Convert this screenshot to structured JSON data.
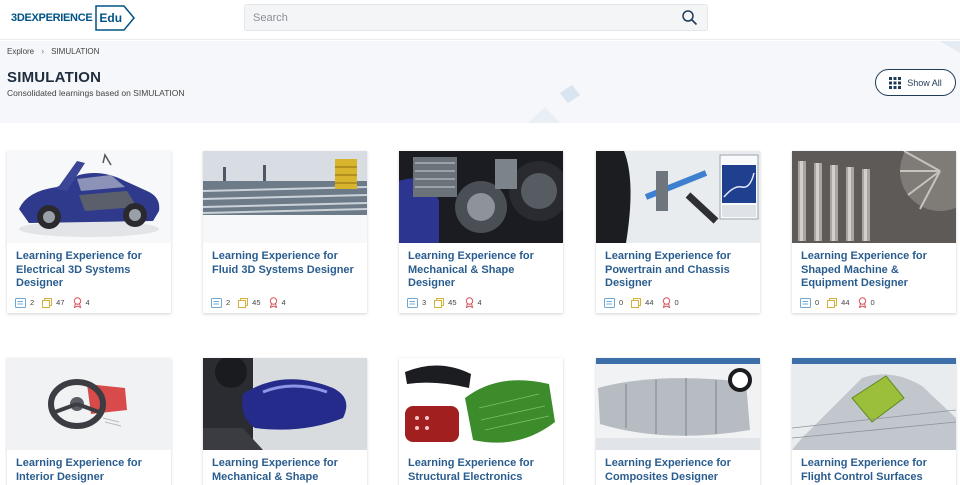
{
  "header": {
    "logo_text": "3DEXPERIENCE",
    "logo_badge": "Edu",
    "search_placeholder": "Search"
  },
  "breadcrumb": {
    "items": [
      "Explore",
      "SIMULATION"
    ]
  },
  "page": {
    "title": "SIMULATION",
    "subtitle": "Consolidated learnings based on SIMULATION",
    "show_all_label": "Show All"
  },
  "colors": {
    "brand": "#005386",
    "card_title": "#2a5d8f",
    "hero_bg": "#f5f7fa"
  },
  "cards": [
    {
      "title": "Learning Experience for Electrical 3D Systems Designer",
      "courses": "2",
      "resources": "47",
      "badges": "4",
      "image": "car-cutaway-icon"
    },
    {
      "title": "Learning Experience for Fluid 3D Systems Designer",
      "courses": "2",
      "resources": "45",
      "badges": "4",
      "image": "refinery-pipes-icon"
    },
    {
      "title": "Learning Experience for Mechanical & Shape Designer",
      "courses": "3",
      "resources": "45",
      "badges": "4",
      "image": "motorcycle-engine-icon"
    },
    {
      "title": "Learning Experience for Powertrain and Chassis Designer",
      "courses": "0",
      "resources": "44",
      "badges": "0",
      "image": "suspension-graph-icon"
    },
    {
      "title": "Learning Experience for Shaped Machine & Equipment Designer",
      "courses": "0",
      "resources": "44",
      "badges": "0",
      "image": "turbine-blades-icon"
    },
    {
      "title": "Learning Experience for Interior Designer",
      "image": "steering-wheel-icon"
    },
    {
      "title": "Learning Experience for Mechanical & Shape",
      "image": "motorcycle-tank-icon"
    },
    {
      "title": "Learning Experience for Structural Electronics",
      "image": "electronic-panels-icon"
    },
    {
      "title": "Learning Experience for Composites Designer",
      "image": "fuselage-cad-icon"
    },
    {
      "title": "Learning Experience for Flight Control Surfaces",
      "image": "wing-surface-icon"
    }
  ]
}
